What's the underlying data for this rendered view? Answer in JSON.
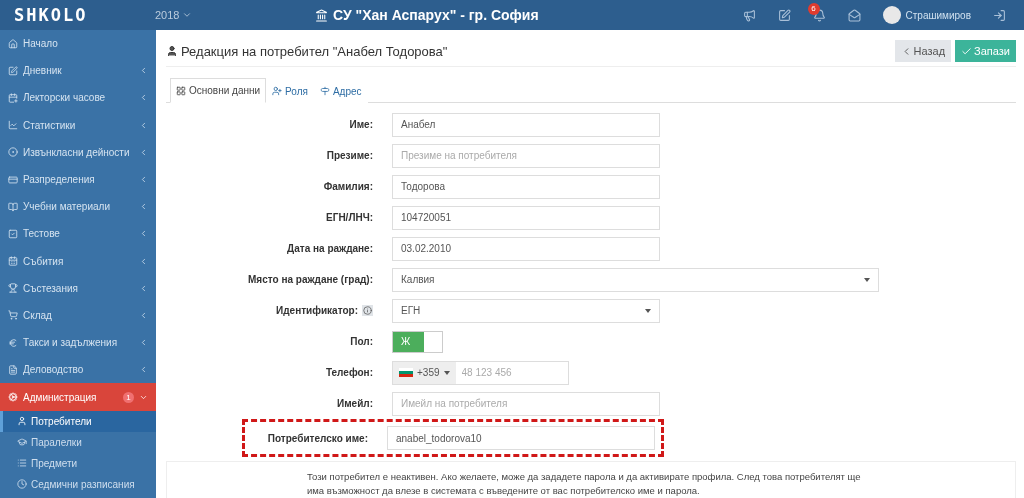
{
  "topbar": {
    "logo": "SHKOLO",
    "year": "2018",
    "school": "СУ \"Хан Аспарух\" - гр. София",
    "notifications": "6",
    "user": "Страшимиров"
  },
  "sidebar": {
    "items": [
      {
        "label": "Начало",
        "has_children": false,
        "expanded": false
      },
      {
        "label": "Дневник",
        "has_children": true,
        "expanded": false
      },
      {
        "label": "Лекторски часове",
        "has_children": true,
        "expanded": false
      },
      {
        "label": "Статистики",
        "has_children": true,
        "expanded": false
      },
      {
        "label": "Извънкласни дейности",
        "has_children": true,
        "expanded": false
      },
      {
        "label": "Разпределения",
        "has_children": true,
        "expanded": false
      },
      {
        "label": "Учебни материали",
        "has_children": true,
        "expanded": false
      },
      {
        "label": "Тестове",
        "has_children": true,
        "expanded": false
      },
      {
        "label": "Събития",
        "has_children": true,
        "expanded": false
      },
      {
        "label": "Състезания",
        "has_children": true,
        "expanded": false
      },
      {
        "label": "Склад",
        "has_children": true,
        "expanded": false
      },
      {
        "label": "Такси и задължения",
        "has_children": true,
        "expanded": false
      },
      {
        "label": "Деловодство",
        "has_children": true,
        "expanded": false
      },
      {
        "label": "Администрация",
        "has_children": true,
        "expanded": true,
        "badge": "1",
        "children": [
          {
            "label": "Потребители",
            "selected": true
          },
          {
            "label": "Паралелки",
            "selected": false
          },
          {
            "label": "Предмети",
            "selected": false
          },
          {
            "label": "Седмични разписания",
            "selected": false
          }
        ]
      }
    ]
  },
  "page": {
    "title": "Редакция на потребител \"Анабел Тодорова\"",
    "buttons": [
      {
        "label": "Назад",
        "kind": "back"
      },
      {
        "label": "Запази",
        "kind": "save"
      }
    ]
  },
  "tabs": [
    {
      "label": "Основни данни",
      "selected": true
    },
    {
      "label": "Роля",
      "selected": false
    },
    {
      "label": "Адрес",
      "selected": false
    }
  ],
  "form": [
    {
      "kind": "text",
      "label": "Име:",
      "value": "Анабел"
    },
    {
      "kind": "text",
      "label": "Презиме:",
      "placeholder": "Презиме на потребителя"
    },
    {
      "kind": "text",
      "label": "Фамилия:",
      "value": "Тодорова"
    },
    {
      "kind": "text",
      "label": "ЕГН/ЛНЧ:",
      "value": "104720051"
    },
    {
      "kind": "text",
      "label": "Дата на раждане:",
      "value": "03.02.2010"
    },
    {
      "kind": "wide-select",
      "label": "Място на раждане (град):",
      "value": "Калвия"
    },
    {
      "kind": "select",
      "label": "Идентификатор:",
      "value": "ЕГН",
      "info": true
    },
    {
      "kind": "toggle",
      "label": "Пол:",
      "value": "Ж",
      "on": true
    },
    {
      "kind": "phone",
      "label": "Телефон:",
      "code": "+359",
      "placeholder": "48 123 456"
    },
    {
      "kind": "text",
      "label": "Имейл:",
      "placeholder": "Имейл на потребителя"
    },
    {
      "kind": "text",
      "label": "Потребителско име:",
      "value": "anabel_todorova10",
      "highlighted": true
    }
  ],
  "notice": "Този потребител е неактивен. Ако желаете, може да зададете парола и да активирате профила. След това потребителят ще има възможност да влезе в системата с въведените от вас потребителско име и парола."
}
